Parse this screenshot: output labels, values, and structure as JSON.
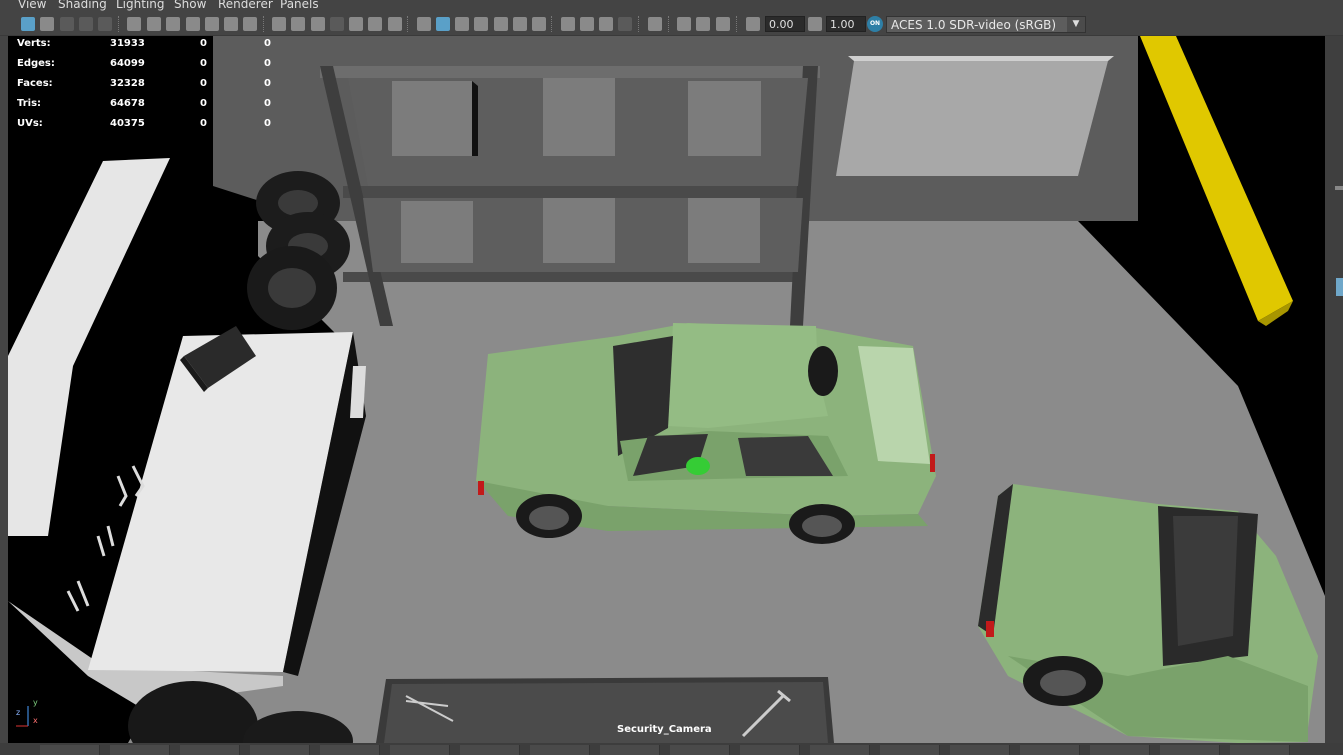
{
  "menu": [
    "View",
    "Shading",
    "Lighting",
    "Show",
    "Renderer",
    "Panels"
  ],
  "toolbar": {
    "exposure_value": "0.00",
    "gamma_value": "1.00",
    "color_management_badge": "ON",
    "color_space": "ACES 1.0 SDR-video (sRGB)",
    "dropdown_arrow": "▼"
  },
  "hud": {
    "rows": [
      {
        "label": "Verts:",
        "v1": "31933",
        "v2": "0",
        "v3": "0"
      },
      {
        "label": "Edges:",
        "v1": "64099",
        "v2": "0",
        "v3": "0"
      },
      {
        "label": "Faces:",
        "v1": "32328",
        "v2": "0",
        "v3": "0"
      },
      {
        "label": "Tris:",
        "v1": "64678",
        "v2": "0",
        "v3": "0"
      },
      {
        "label": "UVs:",
        "v1": "40375",
        "v2": "0",
        "v3": "0"
      }
    ]
  },
  "viewport": {
    "camera_name": "Security_Camera",
    "axis_labels": {
      "x": "x",
      "y": "y",
      "z": "z"
    }
  },
  "colors": {
    "car_body": "#8cb37c",
    "floor": "#8a8a8a",
    "selection_blue": "#5aa0c8",
    "pole_yellow": "#e0c800"
  }
}
